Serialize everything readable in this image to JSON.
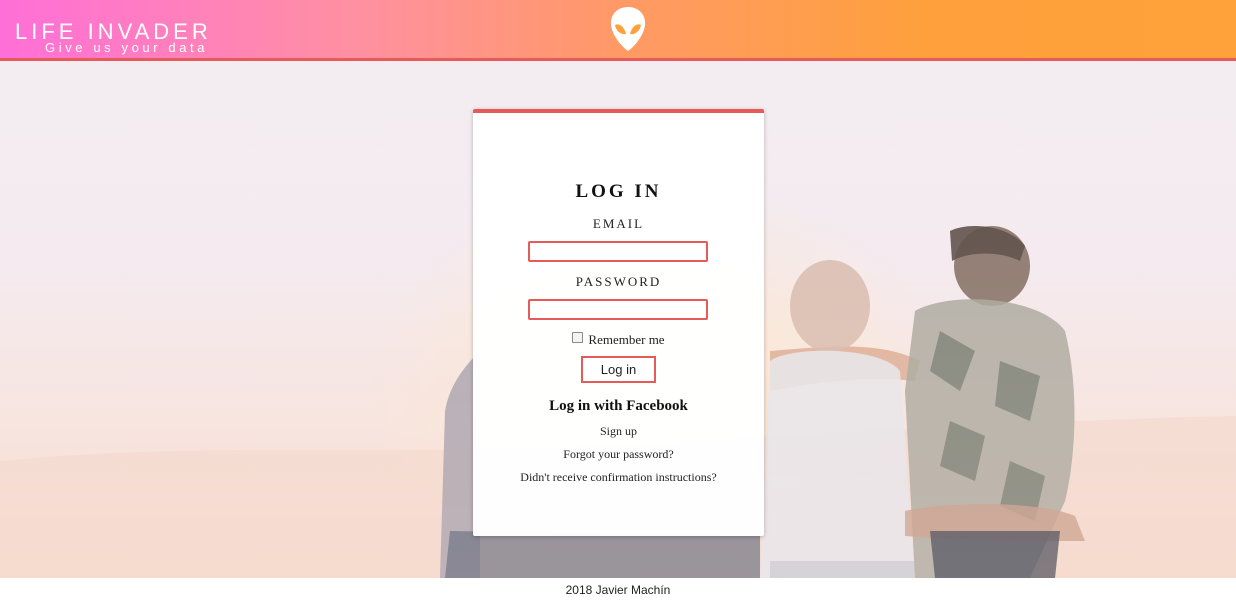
{
  "header": {
    "brand_title": "LIFE INVADER",
    "brand_tagline": "Give us your data",
    "logo_icon": "alien-head-icon",
    "gradient_colors": [
      "#ff6fd8",
      "#ff9a66",
      "#ffa23a"
    ],
    "border_color": "#e65a5a"
  },
  "login": {
    "title": "LOG IN",
    "email_label": "EMAIL",
    "email_value": "",
    "password_label": "PASSWORD",
    "password_value": "",
    "remember_label": "Remember me",
    "remember_checked": false,
    "submit_label": "Log in",
    "facebook_link": "Log in with Facebook",
    "signup_link": "Sign up",
    "forgot_link": "Forgot your password?",
    "confirm_link": "Didn't receive confirmation instructions?",
    "accent_color": "#e65a5a"
  },
  "footer": {
    "text": "2018 Javier Machín"
  }
}
